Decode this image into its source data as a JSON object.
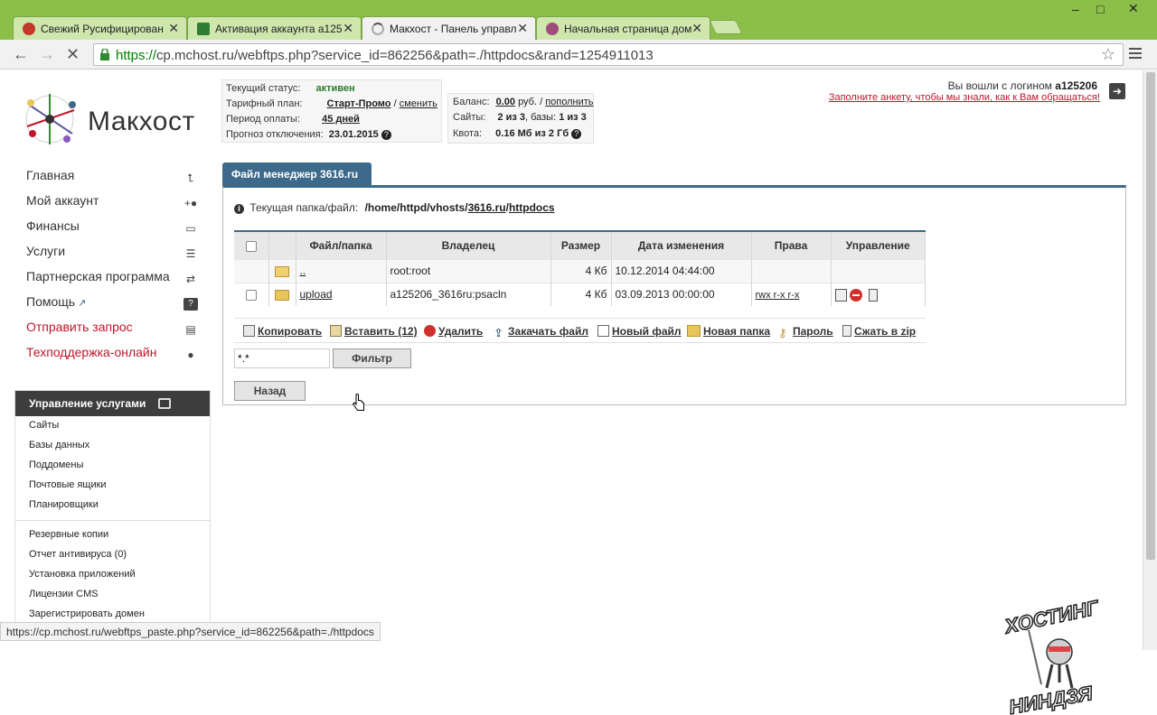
{
  "browser": {
    "tabs": [
      {
        "title": "Свежий Русифицирован",
        "icon_color": "#c0392b"
      },
      {
        "title": "Активация аккаунта a125",
        "icon_color": "#2e7d32"
      },
      {
        "title": "Макхост - Панель управл",
        "icon_color": "#888888"
      },
      {
        "title": "Начальная страница дом",
        "icon_color": "#9c4d7a"
      }
    ],
    "window_controls": [
      "–",
      "□",
      "✕"
    ],
    "url_protocol": "https://",
    "url_domain": "cp.mchost.ru",
    "url_path": "/webftps.php?service_id=862256&path=./httpdocs&rand=1254911013",
    "status_url": "https://cp.mchost.ru/webftps_paste.php?service_id=862256&path=./httpdocs"
  },
  "brand": {
    "name": "Макхост"
  },
  "account": {
    "status_label": "Текущий статус:",
    "status_value": "активен",
    "plan_label": "Тарифный план:",
    "plan_value": "Старт-Промо",
    "plan_sep": "/",
    "plan_change": "сменить",
    "period_label": "Период оплаты:",
    "period_value": "45 дней",
    "forecast_label": "Прогноз отключения:",
    "forecast_value": "23.01.2015",
    "balance_label": "Баланс:",
    "balance_value": "0.00",
    "balance_currency": "руб. /",
    "balance_topup": "пополнить",
    "sites_label": "Сайты:",
    "sites_value": "2 из 3",
    "db_label": ", базы:",
    "db_value": "1 из 3",
    "quota_label": "Квота:",
    "quota_value": "0.16 Мб из 2 Гб",
    "login_prefix": "Вы вошли с логином",
    "login": "a125206",
    "form_link": "Заполните анкету, чтобы мы знали, как к Вам обращаться!"
  },
  "nav": [
    {
      "label": "Главная",
      "icon": "up-arrow-icon",
      "glyph": "⮤",
      "red": false
    },
    {
      "label": "Мой аккаунт",
      "icon": "user-add-icon",
      "glyph": "+●",
      "red": false
    },
    {
      "label": "Финансы",
      "icon": "money-icon",
      "glyph": "▭",
      "red": false
    },
    {
      "label": "Услуги",
      "icon": "list-icon",
      "glyph": "☰",
      "red": false
    },
    {
      "label": "Партнерская программа",
      "icon": "partner-icon",
      "glyph": "⇄",
      "red": false
    },
    {
      "label": "Помощь",
      "icon": "help-icon",
      "glyph": "?",
      "red": false
    },
    {
      "label": "Отправить запрос",
      "icon": "document-icon",
      "glyph": "▤",
      "red": true
    },
    {
      "label": "Техподдержка-онлайн",
      "icon": "chat-icon",
      "glyph": "●",
      "red": true
    }
  ],
  "services": {
    "title": "Управление услугами",
    "group1": [
      "Сайты",
      "Базы данных",
      "Поддомены",
      "Почтовые ящики",
      "Планировщики"
    ],
    "group2": [
      "Резервные копии",
      "Отчет антивируса (0)",
      "Установка приложений",
      "Лицензии CMS",
      "Зарегистрировать домен"
    ]
  },
  "fm": {
    "tab_title": "Файл менеджер 3616.ru",
    "path_label": "Текущая папка/файл:",
    "path_prefix": "/home/httpd/vhosts/",
    "path_site": "3616.ru",
    "path_slash": "/",
    "path_dir": "httpdocs",
    "columns": [
      "Файл/папка",
      "Владелец",
      "Размер",
      "Дата изменения",
      "Права",
      "Управление"
    ],
    "rows": [
      {
        "name": "..",
        "owner": "root:root",
        "size": "4 Кб",
        "date": "10.12.2014 04:44:00",
        "perms": ""
      },
      {
        "name": "upload",
        "owner": "a125206_3616ru:psacln",
        "size": "4 Кб",
        "date": "03.09.2013 00:00:00",
        "perms": "rwx r-x r-x"
      }
    ],
    "actions": {
      "copy": "Копировать",
      "paste": "Вставить (12)",
      "delete": "Удалить",
      "upload": "Закачать файл",
      "new_file": "Новый файл",
      "new_folder": "Новая папка",
      "password": "Пароль",
      "zip": "Сжать в zip"
    },
    "filter_value": "*.*",
    "filter_button": "Фильтр",
    "back_button": "Назад"
  },
  "watermark": {
    "top": "ХОСТИНГ",
    "bottom": "НИНДЗЯ"
  }
}
